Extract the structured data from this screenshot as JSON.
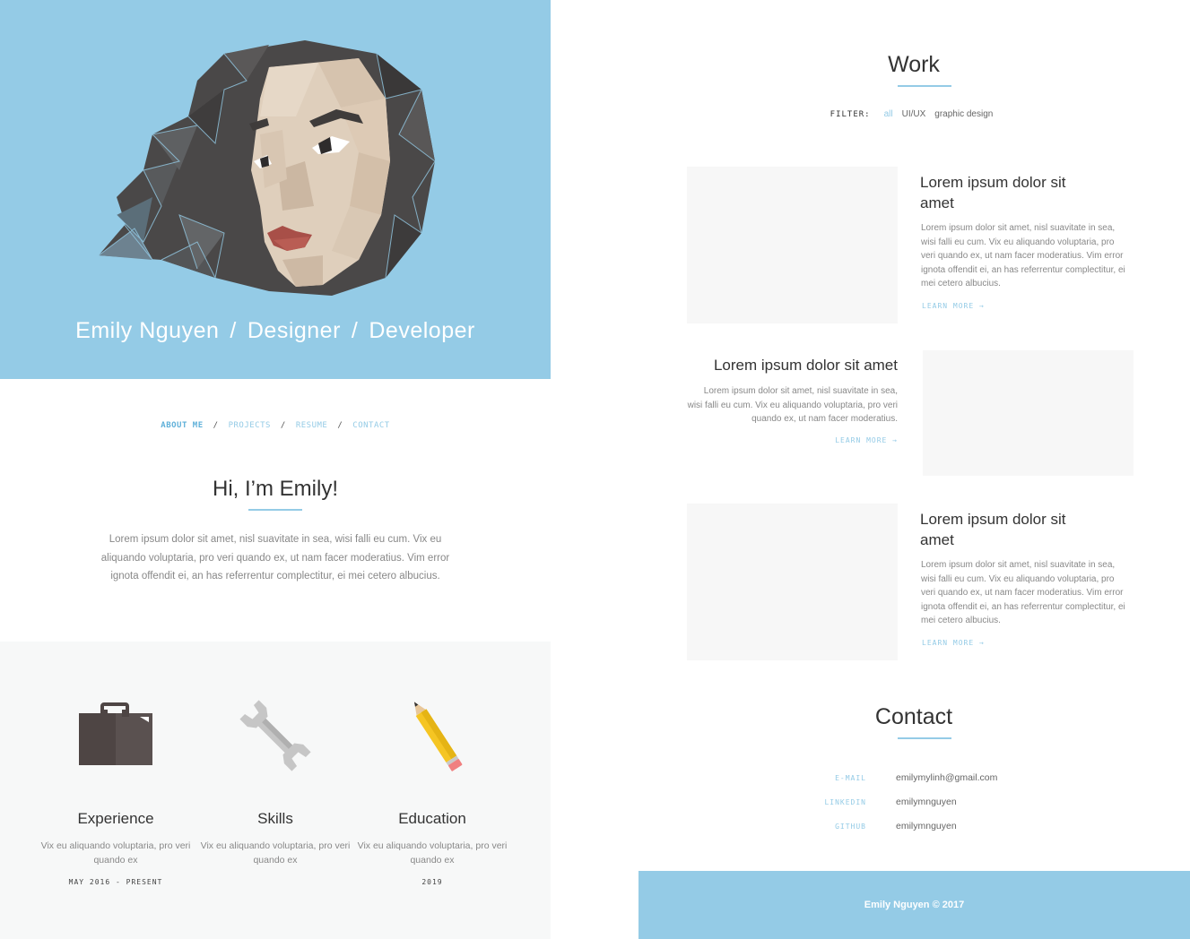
{
  "hero": {
    "name": "Emily Nguyen",
    "role1": "Designer",
    "role2": "Developer",
    "separator": "/",
    "bg_color": "#94cbe6"
  },
  "nav": {
    "items": [
      {
        "label": "ABOUT ME",
        "active": true
      },
      {
        "label": "PROJECTS",
        "active": false
      },
      {
        "label": "RESUME",
        "active": false
      },
      {
        "label": "CONTACT",
        "active": false
      }
    ],
    "separator": "/"
  },
  "about": {
    "title": "Hi, I’m Emily!",
    "text": "Lorem ipsum dolor sit amet, nisl suavitate in sea, wisi falli eu cum. Vix eu aliquando voluptaria, pro veri quando ex, ut nam facer moderatius. Vim error ignota offendit ei, an has referrentur complectitur, ei mei cetero albucius."
  },
  "skills": [
    {
      "icon": "briefcase-icon",
      "title": "Experience",
      "desc": "Vix eu aliquando voluptaria, pro veri quando ex",
      "date": "MAY 2016 - PRESENT"
    },
    {
      "icon": "wrench-icon",
      "title": "Skills",
      "desc": "Vix eu aliquando voluptaria, pro veri quando ex",
      "date": ""
    },
    {
      "icon": "pencil-icon",
      "title": "Education",
      "desc": "Vix eu aliquando voluptaria, pro veri quando ex",
      "date": "2019"
    }
  ],
  "work": {
    "title": "Work",
    "filter_label": "FILTER:",
    "filters": [
      "all",
      "UI/UX",
      "graphic design"
    ],
    "active_filter": "all",
    "projects": [
      {
        "title": "Lorem ipsum dolor sit amet",
        "text": "Lorem ipsum dolor sit amet, nisl suavitate in sea, wisi falli eu cum. Vix eu aliquando voluptaria, pro veri quando ex, ut nam facer moderatius. Vim error ignota offendit ei, an has referrentur complectitur, ei mei cetero albucius.",
        "link": "LEARN MORE →"
      },
      {
        "title": "Lorem ipsum dolor sit amet",
        "text": "Lorem ipsum dolor sit amet, nisl suavitate in sea, wisi falli eu cum. Vix eu aliquando voluptaria, pro veri quando ex, ut nam facer moderatius.",
        "link": "LEARN MORE →"
      },
      {
        "title": "Lorem ipsum dolor sit amet",
        "text": "Lorem ipsum dolor sit amet, nisl suavitate in sea, wisi falli eu cum. Vix eu aliquando voluptaria, pro veri quando ex, ut nam facer moderatius. Vim error ignota offendit ei, an has referrentur complectitur, ei mei cetero albucius.",
        "link": "LEARN MORE →"
      }
    ]
  },
  "contact": {
    "title": "Contact",
    "rows": [
      {
        "key": "E-MAIL",
        "value": "emilymylinh@gmail.com"
      },
      {
        "key": "LINKEDIN",
        "value": "emilymnguyen"
      },
      {
        "key": "GITHUB",
        "value": "emilymnguyen"
      }
    ]
  },
  "footer": {
    "text": "Emily Nguyen © 2017"
  },
  "colors": {
    "accent": "#94cbe6",
    "panel": "#f7f8f8"
  }
}
